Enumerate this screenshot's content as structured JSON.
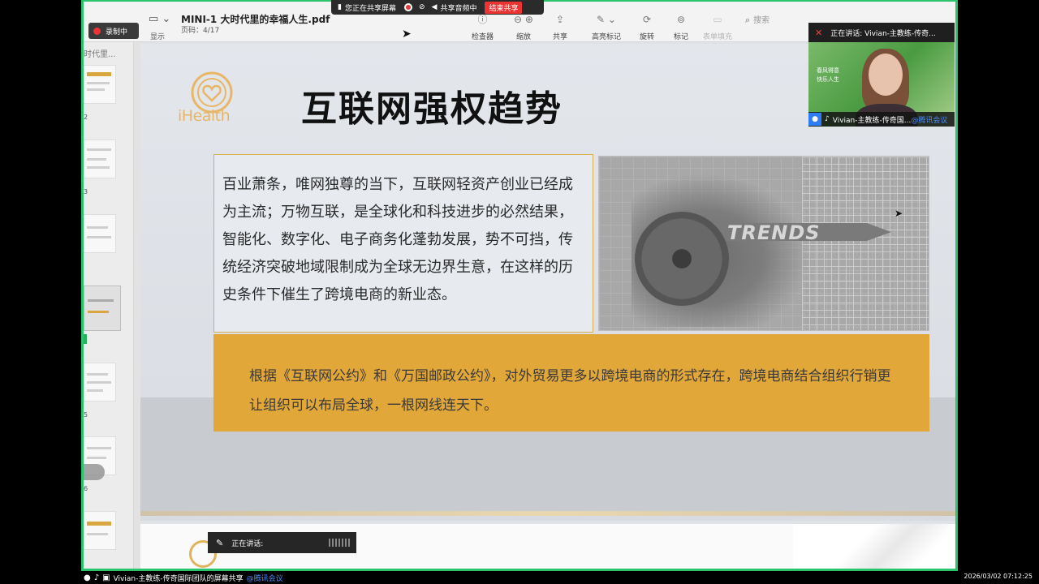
{
  "share_bar": {
    "status": "您正在共享屏幕",
    "audio": "共享音频中",
    "end_button": "结束共享"
  },
  "recording_badge": "录制中",
  "toolbar": {
    "display_label": "显示",
    "doc_title": "MINI-1 大时代里的幸福人生.pdf",
    "page_info": "页码：4/17",
    "tools": [
      {
        "label": "检查器",
        "icon": "info-icon"
      },
      {
        "label": "缩放",
        "icon": "zoom-icon"
      },
      {
        "label": "共享",
        "icon": "share-icon"
      },
      {
        "label": "高亮标记",
        "icon": "highlight-icon"
      },
      {
        "label": "旋转",
        "icon": "rotate-icon"
      },
      {
        "label": "标记",
        "icon": "markup-icon"
      },
      {
        "label": "表单填充",
        "icon": "form-icon"
      }
    ],
    "search_placeholder": "搜索"
  },
  "sidebar": {
    "heading": "时代里...",
    "page_marks": [
      "2",
      "3",
      "5",
      "6"
    ]
  },
  "slide": {
    "logo_text": "iHealth",
    "title": "互联网强权趋势",
    "paragraph": "百业萧条，唯网独尊的当下，互联网轻资产创业已经成为主流；万物互联，是全球化和科技进步的必然结果，智能化、数字化、电子商务化蓬勃发展，势不可挡，传统经济突破地域限制成为全球无边界生意，在这样的历史条件下催生了跨境电商的新业态。",
    "image_text": "TRENDS",
    "highlight": "根据《互联网公约》和《万国邮政公约》，对外贸易更多以跨境电商的形式存在，跨境电商结合组织行销更让组织可以布局全球，一根网线连天下。"
  },
  "video": {
    "speaking_label": "正在讲话:",
    "speaker_name": "Vivian-主教练-传奇...",
    "tile_name": "Vivian-主教练-传奇国...",
    "brand": "@腾讯会议",
    "overlay_text": "春风得意\n快乐人生"
  },
  "speaking_toast": "正在讲话:",
  "bottom_bar": {
    "label": "Vivian-主教练-传奇国际团队的屏幕共享",
    "brand": "@腾讯会议"
  },
  "timestamp": "2026/03/02 07:12:25",
  "colors": {
    "share_border": "#29c46b",
    "gold": "#e2a739",
    "brand_blue": "#4c8dff"
  }
}
